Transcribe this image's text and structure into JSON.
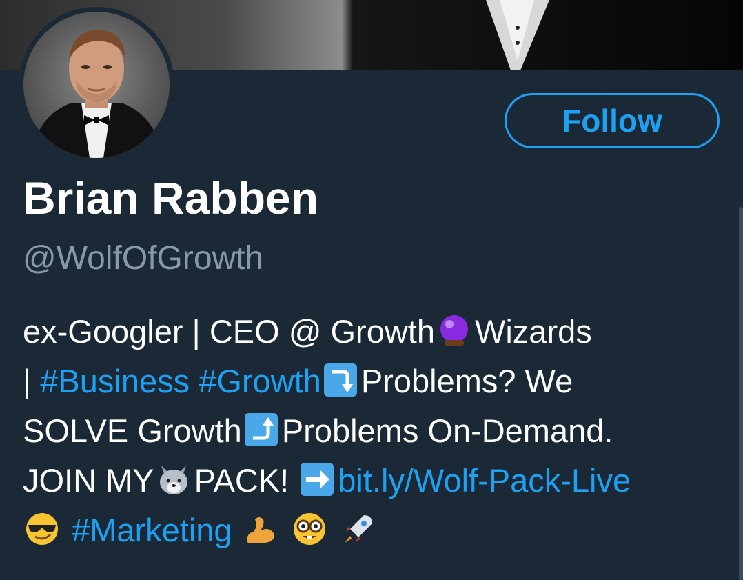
{
  "profile": {
    "name": "Brian Rabben",
    "handle": "@WolfOfGrowth",
    "follow_label": "Follow"
  },
  "bio": {
    "line1_a": "ex-Googler | CEO @ Growth",
    "line1_b": "Wizards",
    "line2_a": "| ",
    "line2_link1": "#Business",
    "line2_link2": "#Growth",
    "line2_b": "Problems? We",
    "line3_a": "SOLVE Growth",
    "line3_b": "Problems On-Demand.",
    "line4_a": "JOIN MY",
    "line4_b": "PACK! ",
    "line4_link": "bit.ly/Wolf-Pack-Live",
    "line5_link": "#Marketing"
  },
  "emojis": {
    "crystal_ball": "crystal-ball-icon",
    "arrow_down": "arrow-right-curving-down-icon",
    "arrow_up": "arrow-right-curving-up-icon",
    "wolf": "wolf-face-icon",
    "arrow_right": "right-arrow-icon",
    "sunglasses": "smiling-face-with-sunglasses-icon",
    "bicep": "flexed-biceps-icon",
    "nerd": "nerd-face-icon",
    "rocket": "rocket-icon"
  },
  "colors": {
    "background": "#1b2836",
    "accent": "#1da1f2",
    "muted": "#8899a6",
    "text": "#ffffff"
  }
}
